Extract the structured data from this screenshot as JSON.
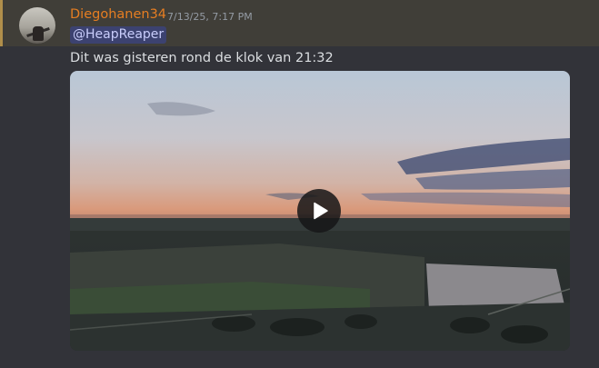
{
  "message": {
    "author": "Diegohanen34",
    "timestamp": "7/13/25, 7:17 PM",
    "mention": "@HeapReaper",
    "text": "Dit was gisteren rond de klok van 21:32"
  },
  "icons": {
    "play": "play-icon"
  },
  "colors": {
    "username": "#e67e22",
    "mention_bg": "#3c4270",
    "mention_highlight": "#403e38",
    "mention_bar": "#b08e4a"
  }
}
